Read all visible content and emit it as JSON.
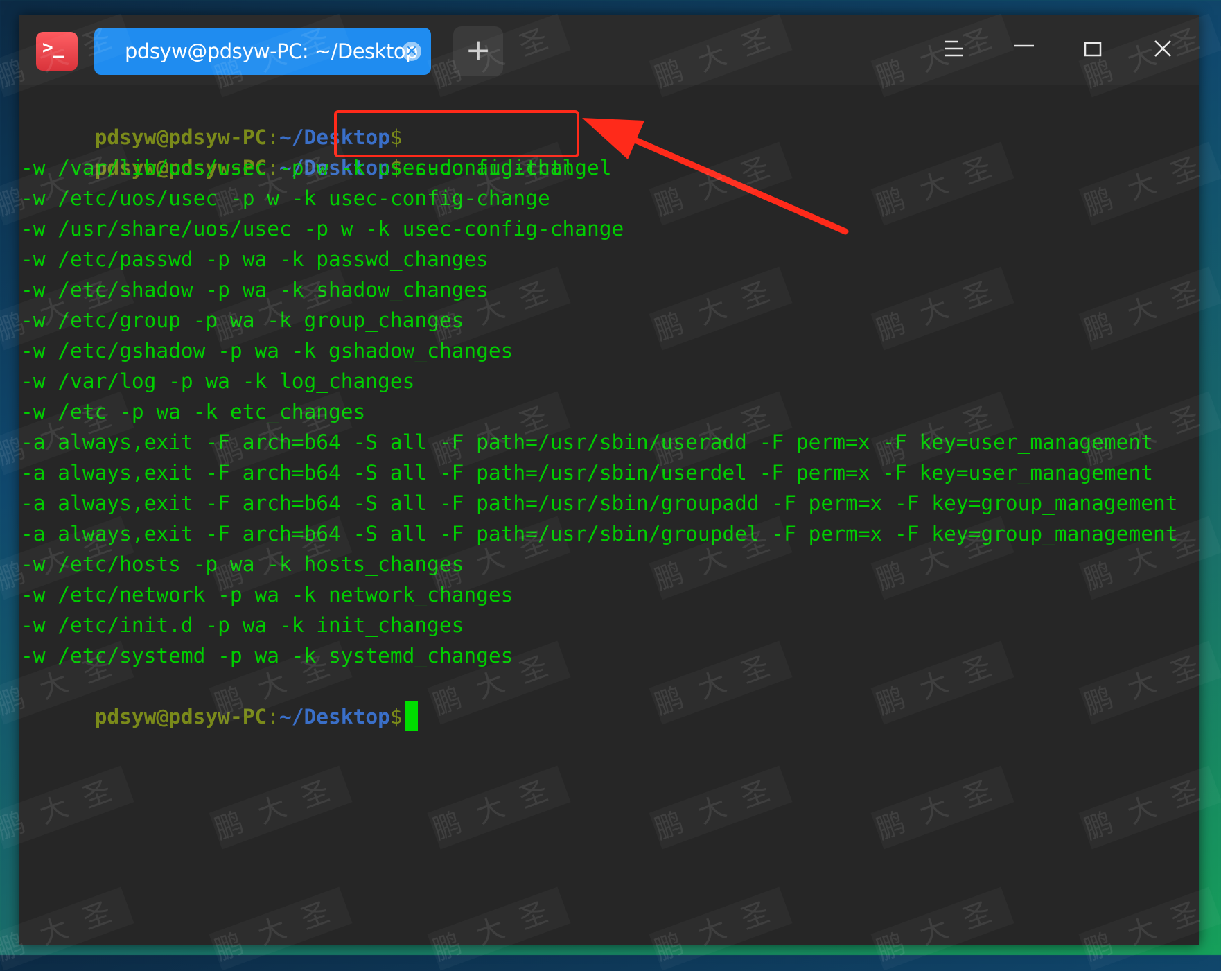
{
  "window": {
    "tab_title": "pdsyw@pdsyw-PC: ~/Desktop",
    "tab_close": "×",
    "new_tab": "+",
    "app_icon_glyph": ">_"
  },
  "prompt": {
    "user_host": "pdsyw@pdsyw-PC",
    "colon": ":",
    "path": "~/Desktop",
    "dollar": "$"
  },
  "command": "sudo auditctl -l",
  "output": [
    "-w /var/lib/uos/usec -p w -k usec-config-change",
    "-w /etc/uos/usec -p w -k usec-config-change",
    "-w /usr/share/uos/usec -p w -k usec-config-change",
    "-w /etc/passwd -p wa -k passwd_changes",
    "-w /etc/shadow -p wa -k shadow_changes",
    "-w /etc/group -p wa -k group_changes",
    "-w /etc/gshadow -p wa -k gshadow_changes",
    "-w /var/log -p wa -k log_changes",
    "-w /etc -p wa -k etc_changes",
    "-a always,exit -F arch=b64 -S all -F path=/usr/sbin/useradd -F perm=x -F key=user_management",
    "-a always,exit -F arch=b64 -S all -F path=/usr/sbin/userdel -F perm=x -F key=user_management",
    "-a always,exit -F arch=b64 -S all -F path=/usr/sbin/groupadd -F perm=x -F key=group_management",
    "-a always,exit -F arch=b64 -S all -F path=/usr/sbin/groupdel -F perm=x -F key=group_management",
    "-w /etc/hosts -p wa -k hosts_changes",
    "-w /etc/network -p wa -k network_changes",
    "-w /etc/init.d -p wa -k init_changes",
    "-w /etc/systemd -p wa -k systemd_changes"
  ],
  "watermark_text": "鹏大圣",
  "colors": {
    "terminal_bg": "#262626",
    "output_green": "#00cc00",
    "prompt_olive": "#7a8a1a",
    "prompt_path_blue": "#3a6fc8",
    "tab_blue": "#1f8cf0",
    "annotation_red": "#ff2a1a"
  }
}
